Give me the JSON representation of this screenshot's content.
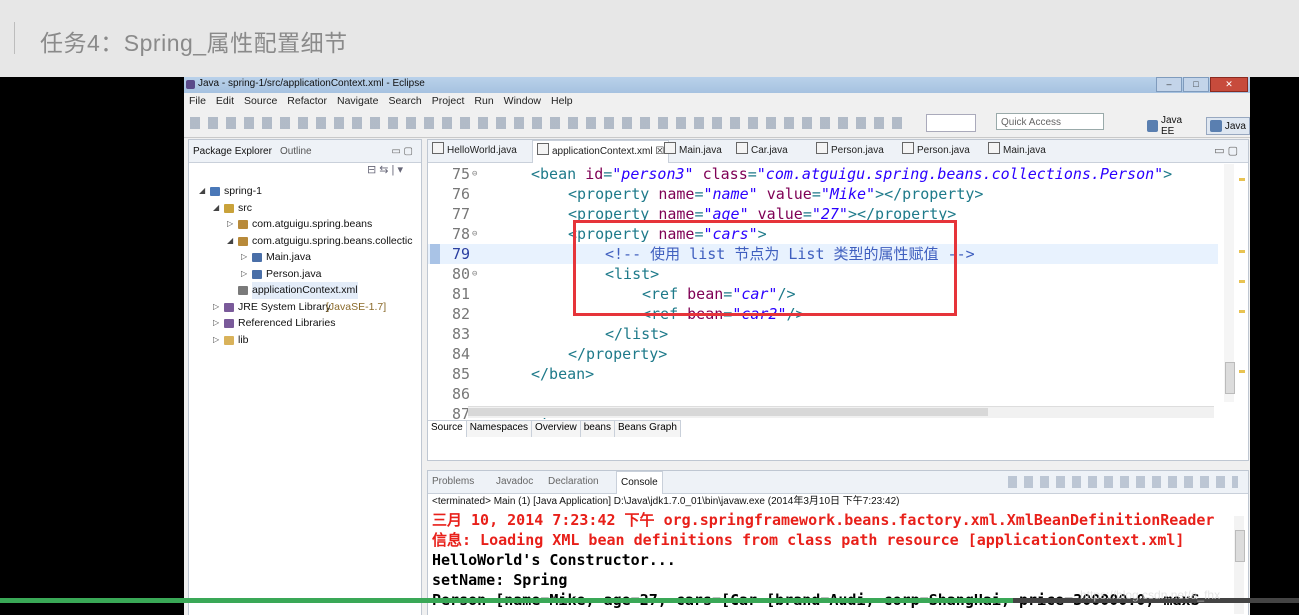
{
  "page_title": "任务4：Spring_属性配置细节",
  "window": {
    "title": "Java - spring-1/src/applicationContext.xml - Eclipse",
    "buttons": [
      "–",
      "□",
      "✕"
    ]
  },
  "menu": [
    "File",
    "Edit",
    "Source",
    "Refactor",
    "Navigate",
    "Search",
    "Project",
    "Run",
    "Window",
    "Help"
  ],
  "toolbar": {
    "quick_access_placeholder": "Quick Access",
    "perspectives": [
      {
        "label": "Java EE",
        "active": false
      },
      {
        "label": "Java",
        "active": true
      }
    ]
  },
  "package_explorer": {
    "tabs": [
      "Package Explorer",
      "Outline"
    ],
    "tree": [
      {
        "label": "spring-1",
        "depth": 0,
        "expanded": true,
        "icon": "project-icon"
      },
      {
        "label": "src",
        "depth": 1,
        "expanded": true,
        "icon": "source-folder-icon"
      },
      {
        "label": "com.atguigu.spring.beans",
        "depth": 2,
        "expanded": false,
        "icon": "package-icon"
      },
      {
        "label": "com.atguigu.spring.beans.collectic",
        "depth": 2,
        "expanded": true,
        "icon": "package-icon"
      },
      {
        "label": "Main.java",
        "depth": 3,
        "expanded": false,
        "icon": "java-file-icon"
      },
      {
        "label": "Person.java",
        "depth": 3,
        "expanded": false,
        "icon": "java-file-icon"
      },
      {
        "label": "applicationContext.xml",
        "depth": 2,
        "leaf": true,
        "selected": true,
        "icon": "xml-file-icon"
      },
      {
        "label": "JRE System Library",
        "suffix": "[JavaSE-1.7]",
        "depth": 1,
        "expanded": false,
        "icon": "library-icon"
      },
      {
        "label": "Referenced Libraries",
        "depth": 1,
        "expanded": false,
        "icon": "library-icon"
      },
      {
        "label": "lib",
        "depth": 1,
        "expanded": false,
        "icon": "folder-icon"
      }
    ]
  },
  "editor": {
    "tabs": [
      {
        "label": "HelloWorld.java",
        "active": false
      },
      {
        "label": "applicationContext.xml",
        "active": true
      },
      {
        "label": "Main.java",
        "active": false
      },
      {
        "label": "Car.java",
        "active": false
      },
      {
        "label": "Person.java",
        "active": false
      },
      {
        "label": "Person.java",
        "active": false
      },
      {
        "label": "Main.java",
        "active": false
      }
    ],
    "current_line": "79",
    "lines": [
      {
        "n": "75",
        "fold": true,
        "indent": 1,
        "tokens": [
          [
            "tg",
            "<bean "
          ],
          [
            "at",
            "id"
          ],
          [
            "tg",
            "="
          ],
          [
            "st",
            "\"person3\""
          ],
          [
            "tg",
            " "
          ],
          [
            "at",
            "class"
          ],
          [
            "tg",
            "="
          ],
          [
            "st",
            "\"com.atguigu.spring.beans.collections.Person\""
          ],
          [
            "tg",
            ">"
          ]
        ]
      },
      {
        "n": "76",
        "fold": false,
        "indent": 2,
        "tokens": [
          [
            "tg",
            "<property "
          ],
          [
            "at",
            "name"
          ],
          [
            "tg",
            "="
          ],
          [
            "st",
            "\"name\""
          ],
          [
            "tg",
            " "
          ],
          [
            "at",
            "value"
          ],
          [
            "tg",
            "="
          ],
          [
            "st",
            "\"Mike\""
          ],
          [
            "tg",
            "></property>"
          ]
        ]
      },
      {
        "n": "77",
        "fold": false,
        "indent": 2,
        "tokens": [
          [
            "tg",
            "<property "
          ],
          [
            "at",
            "name"
          ],
          [
            "tg",
            "="
          ],
          [
            "st",
            "\"age\""
          ],
          [
            "tg",
            " "
          ],
          [
            "at",
            "value"
          ],
          [
            "tg",
            "="
          ],
          [
            "st",
            "\"27\""
          ],
          [
            "tg",
            "></property>"
          ]
        ]
      },
      {
        "n": "78",
        "fold": true,
        "indent": 2,
        "tokens": [
          [
            "tg",
            "<property "
          ],
          [
            "at",
            "name"
          ],
          [
            "tg",
            "="
          ],
          [
            "st",
            "\"cars\""
          ],
          [
            "tg",
            ">"
          ]
        ]
      },
      {
        "n": "79",
        "fold": false,
        "indent": 3,
        "tokens": [
          [
            "cm",
            "<!-- 使用 list 节点为 List 类型的属性赋值 -->"
          ]
        ]
      },
      {
        "n": "80",
        "fold": true,
        "indent": 3,
        "tokens": [
          [
            "tg",
            "<list>"
          ]
        ]
      },
      {
        "n": "81",
        "fold": false,
        "indent": 4,
        "tokens": [
          [
            "tg",
            "<ref "
          ],
          [
            "at",
            "bean"
          ],
          [
            "tg",
            "="
          ],
          [
            "st",
            "\"car\""
          ],
          [
            "tg",
            "/>"
          ]
        ]
      },
      {
        "n": "82",
        "fold": false,
        "indent": 4,
        "tokens": [
          [
            "tg",
            "<ref "
          ],
          [
            "at",
            "bean"
          ],
          [
            "tg",
            "="
          ],
          [
            "st",
            "\"car2\""
          ],
          [
            "tg",
            "/>"
          ]
        ]
      },
      {
        "n": "83",
        "fold": false,
        "indent": 3,
        "tokens": [
          [
            "tg",
            "</list>"
          ]
        ]
      },
      {
        "n": "84",
        "fold": false,
        "indent": 2,
        "tokens": [
          [
            "tg",
            "</property>"
          ]
        ]
      },
      {
        "n": "85",
        "fold": false,
        "indent": 1,
        "tokens": [
          [
            "tg",
            "</bean>"
          ]
        ]
      },
      {
        "n": "86",
        "fold": false,
        "indent": 0,
        "tokens": []
      },
      {
        "n": "87",
        "fold": true,
        "indent": 1,
        "tokens": [
          [
            "tg",
            "<!--"
          ]
        ]
      }
    ],
    "bottom_tabs": [
      "Source",
      "Namespaces",
      "Overview",
      "beans",
      "Beans Graph"
    ]
  },
  "console": {
    "tabs": [
      {
        "label": "Problems",
        "active": false
      },
      {
        "label": "Javadoc",
        "active": false
      },
      {
        "label": "Declaration",
        "active": false
      },
      {
        "label": "Console",
        "active": true
      }
    ],
    "status": "<terminated> Main (1) [Java Application] D:\\Java\\jdk1.7.0_01\\bin\\javaw.exe (2014年3月10日 下午7:23:42)",
    "lines": [
      {
        "text": "三月 10, 2014 7:23:42 下午 org.springframework.beans.factory.xml.XmlBeanDefinitionReader",
        "color": "red"
      },
      {
        "text": "信息: Loading XML bean definitions from class path resource [applicationContext.xml]",
        "color": "red"
      },
      {
        "text": "HelloWorld's Constructor...",
        "color": "black"
      },
      {
        "text": "setName: Spring",
        "color": "black"
      },
      {
        "text": "Person [name=Mike, age=27, cars=[Car [brand=Audi, corp=ShangHai, price=300000.0, maxS",
        "color": "black"
      }
    ]
  },
  "video": {
    "progress": 0.78
  },
  "watermark": "https://blog.csdn.net/a_fhx",
  "colors": {
    "highlight_box": "#e6343a",
    "progress": "#3aa857"
  }
}
